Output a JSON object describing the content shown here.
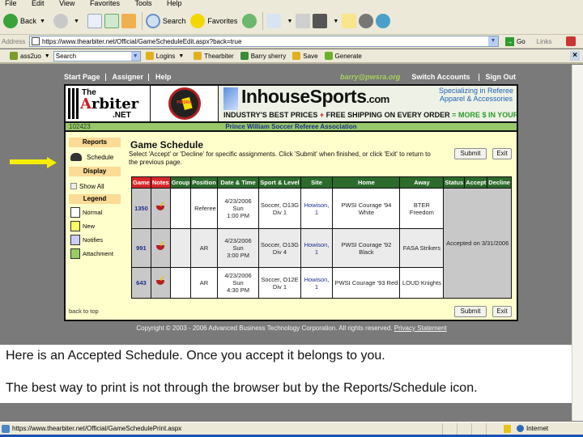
{
  "browser": {
    "menu": [
      "File",
      "Edit",
      "View",
      "Favorites",
      "Tools",
      "Help"
    ],
    "toolbar": {
      "back_label": "Back",
      "search_label": "Search",
      "favorites_label": "Favorites"
    },
    "address": {
      "label": "Address",
      "url": "https://www.thearbiter.net/Official/GameScheduleEdit.aspx?back=true",
      "go_label": "Go",
      "links_label": "Links"
    },
    "links_bar": {
      "toolbar_name": "ass2uo",
      "search_placeholder": "Search",
      "items": [
        "Logins",
        "Thearbiter",
        "Barry sherry",
        "Save",
        "Generate"
      ]
    },
    "status": {
      "url": "https://www.thearbiter.net/Official/GameSchedulePrint.aspx",
      "zone": "Internet"
    }
  },
  "site": {
    "nav": {
      "start_page": "Start Page",
      "assigner": "Assigner",
      "help": "Help",
      "email": "barry@pwsra.org",
      "switch_accounts": "Switch Accounts",
      "sign_out": "Sign Out"
    },
    "banner": {
      "arbiter_the": "The",
      "arbiter_name_a": "A",
      "arbiter_name_rest": "rbiter",
      "arbiter_net": ".NET",
      "pwsra_text": "PWSRA",
      "ad_main": "InhouseSports",
      "ad_tld": ".com",
      "ad_side_1": "Specializing in Referee",
      "ad_side_2": "Apparel & Accessories",
      "ad_sub_1": "INDUSTRY'S BEST PRICES",
      "ad_plus": "+",
      "ad_sub_2": "FREE SHIPPING ON EVERY ORDER",
      "ad_eq": "=",
      "ad_sub_3": "MORE $ IN YOUR POCKET"
    },
    "account_id": "102423",
    "org_name": "Prince William Soccer Referee Association",
    "sidebar": {
      "reports": "Reports",
      "schedule": "Schedule",
      "display": "Display",
      "show_all": "Show All",
      "legend": "Legend",
      "legend_items": [
        {
          "label": "Normal",
          "color": "#ffffff"
        },
        {
          "label": "New",
          "color": "#ffff66"
        },
        {
          "label": "Notifies",
          "color": "#ccccff"
        },
        {
          "label": "Attachment",
          "color": "#99cc66"
        }
      ],
      "back_to_top": "back to top"
    },
    "main": {
      "title": "Game Schedule",
      "instructions": "Select 'Accept' or 'Decline' for specific assignments. Click 'Submit' when finished, or click 'Exit' to return to the previous page.",
      "submit": "Submit",
      "exit": "Exit",
      "columns": [
        "Game",
        "Notes",
        "Group",
        "Position",
        "Date & Time",
        "Sport & Level",
        "Site",
        "Home",
        "Away",
        "Status",
        "Accept",
        "Decline"
      ],
      "rows": [
        {
          "game": "1350",
          "group": "",
          "position": "Referee",
          "date": "4/23/2006 Sun",
          "time": "1:00 PM",
          "sport": "Soccer, O13G",
          "level": "Div 1",
          "site": "Howison, 1",
          "home": "PWSI Courage '94 White",
          "away": "BTER Freedom"
        },
        {
          "game": "991",
          "group": "",
          "position": "AR",
          "date": "4/23/2006 Sun",
          "time": "3:00 PM",
          "sport": "Soccer, O13G",
          "level": "Div 4",
          "site": "Howison, 1",
          "home": "PWSI Courage '92 Black",
          "away": "FASA Strikers"
        },
        {
          "game": "643",
          "group": "",
          "position": "AR",
          "date": "4/23/2006 Sun",
          "time": "4:30 PM",
          "sport": "Soccer, O12E",
          "level": "Div 1",
          "site": "Howison, 1",
          "home": "PWSI Courage '93 Red",
          "away": "LOUD Knights"
        }
      ],
      "status_text": "Accepted on 3/31/2006"
    },
    "footer": {
      "copyright": "Copyright © 2003 - 2006 Advanced Business Technology Corporation. All rights reserved.",
      "privacy": "Privacy Statement"
    }
  },
  "caption": {
    "line1": "Here is an Accepted Schedule. Once you accept it belongs to you.",
    "line2": "The best way to print is not through the browser but by the Reports/Schedule icon."
  }
}
